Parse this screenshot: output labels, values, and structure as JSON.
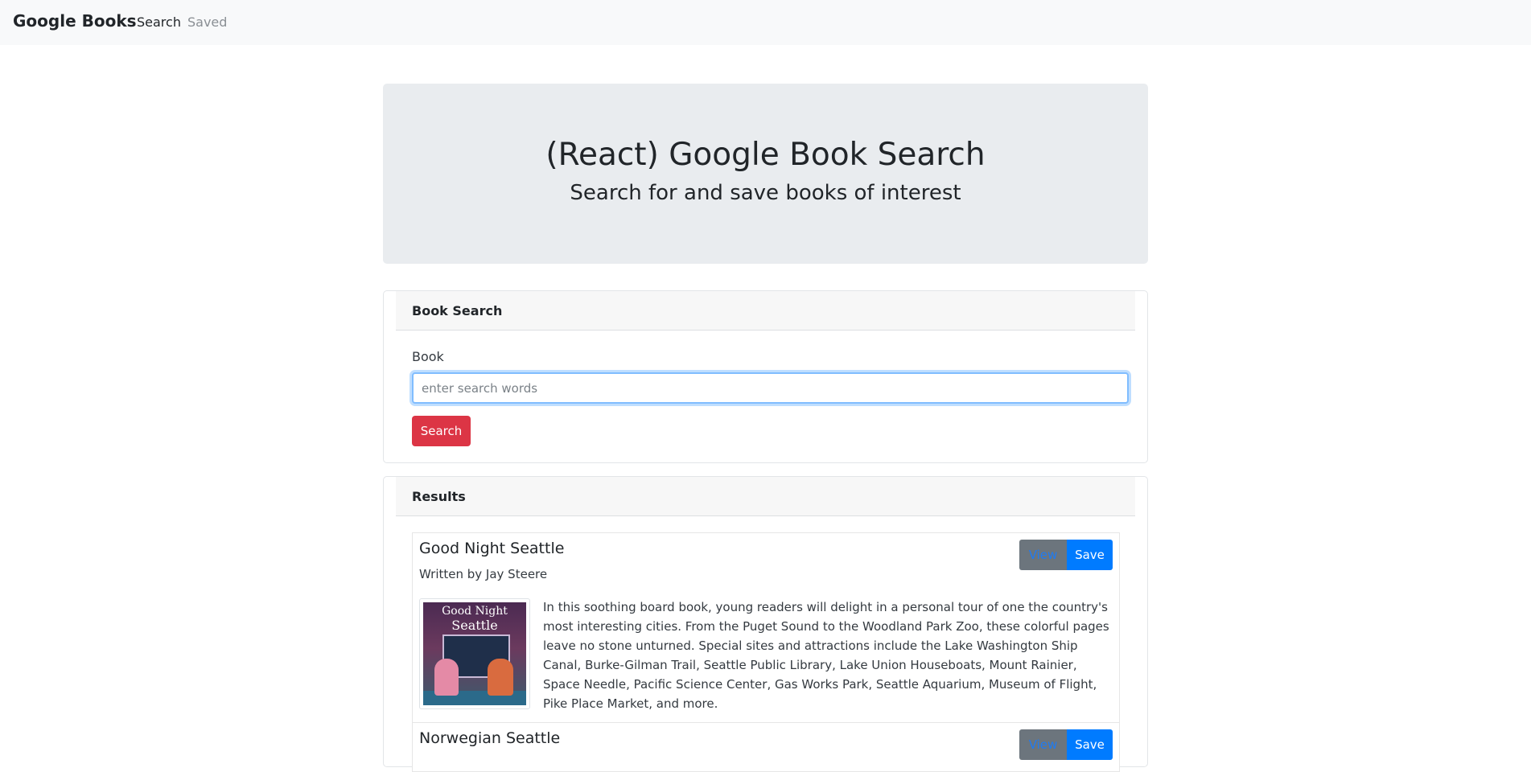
{
  "navbar": {
    "brand": "Google Books",
    "links": [
      {
        "label": "Search",
        "active": true
      },
      {
        "label": "Saved",
        "active": false
      }
    ]
  },
  "jumbotron": {
    "title": "(React) Google Book Search",
    "subtitle": "Search for and save books of interest"
  },
  "search_card": {
    "header": "Book Search",
    "field_label": "Book",
    "input": {
      "value": "",
      "placeholder": "enter search words"
    },
    "button_label": "Search"
  },
  "results_card": {
    "header": "Results",
    "books": [
      {
        "title": "Good Night Seattle",
        "author": "Written by Jay Steere",
        "view_label": "View",
        "save_label": "Save",
        "cover_line1": "Good Night",
        "cover_line2": "Seattle",
        "description": "In this soothing board book, young readers will delight in a personal tour of one the country's most interesting cities. From the Puget Sound to the Woodland Park Zoo, these colorful pages leave no stone unturned. Special sites and attractions include the Lake Washington Ship Canal, Burke-Gilman Trail, Seattle Public Library, Lake Union Houseboats, Mount Rainier, Space Needle, Pacific Science Center, Gas Works Park, Seattle Aquarium, Museum of Flight, Pike Place Market, and more."
      },
      {
        "title": "Norwegian Seattle",
        "view_label": "View",
        "save_label": "Save"
      }
    ]
  },
  "colors": {
    "navbar_bg": "#f8f9fa",
    "jumbotron_bg": "#e9ecef",
    "search_button": "#dc3545",
    "view_button": "#6c757d",
    "save_button": "#007bff"
  }
}
